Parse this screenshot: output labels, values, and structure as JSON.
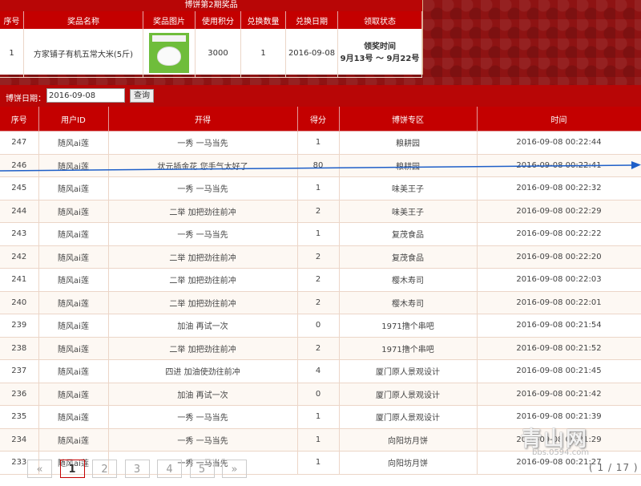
{
  "prize": {
    "title": "博饼第2期奖品",
    "headers": [
      "序号",
      "奖品名称",
      "奖品图片",
      "使用积分",
      "兑换数量",
      "兑换日期",
      "领取状态"
    ],
    "row": {
      "index": "1",
      "name": "方家铺子有机五常大米(5斤)",
      "points": "3000",
      "quantity": "1",
      "date": "2016-09-08",
      "claim_title": "领奖时间",
      "claim_range": "9月13号 ～ 9月22号"
    }
  },
  "filter": {
    "label": "博饼日期：",
    "date_value": "2016-09-08",
    "query_label": "查询"
  },
  "table": {
    "headers": [
      "序号",
      "用户ID",
      "开得",
      "得分",
      "博饼专区",
      "时间"
    ],
    "rows": [
      {
        "no": "247",
        "user": "随风ai莲",
        "result": "一秀 一马当先",
        "score": "1",
        "zone": "粮耕园",
        "time": "2016-09-08 00:22:44"
      },
      {
        "no": "246",
        "user": "随风ai莲",
        "result": "状元插金花 您手气太好了",
        "score": "80",
        "zone": "粮耕园",
        "time": "2016-09-08 00:22:41"
      },
      {
        "no": "245",
        "user": "随风ai莲",
        "result": "一秀 一马当先",
        "score": "1",
        "zone": "味美王子",
        "time": "2016-09-08 00:22:32"
      },
      {
        "no": "244",
        "user": "随风ai莲",
        "result": "二举 加把劲往前冲",
        "score": "2",
        "zone": "味美王子",
        "time": "2016-09-08 00:22:29"
      },
      {
        "no": "243",
        "user": "随风ai莲",
        "result": "一秀 一马当先",
        "score": "1",
        "zone": "复茂食品",
        "time": "2016-09-08 00:22:22"
      },
      {
        "no": "242",
        "user": "随风ai莲",
        "result": "二举 加把劲往前冲",
        "score": "2",
        "zone": "复茂食品",
        "time": "2016-09-08 00:22:20"
      },
      {
        "no": "241",
        "user": "随风ai莲",
        "result": "二举 加把劲往前冲",
        "score": "2",
        "zone": "樱木寿司",
        "time": "2016-09-08 00:22:03"
      },
      {
        "no": "240",
        "user": "随风ai莲",
        "result": "二举 加把劲往前冲",
        "score": "2",
        "zone": "樱木寿司",
        "time": "2016-09-08 00:22:01"
      },
      {
        "no": "239",
        "user": "随风ai莲",
        "result": "加油 再试一次",
        "score": "0",
        "zone": "1971撸个串吧",
        "time": "2016-09-08 00:21:54"
      },
      {
        "no": "238",
        "user": "随风ai莲",
        "result": "二举 加把劲往前冲",
        "score": "2",
        "zone": "1971撸个串吧",
        "time": "2016-09-08 00:21:52"
      },
      {
        "no": "237",
        "user": "随风ai莲",
        "result": "四进 加油使劲往前冲",
        "score": "4",
        "zone": "厦门原人景观设计",
        "time": "2016-09-08 00:21:45"
      },
      {
        "no": "236",
        "user": "随风ai莲",
        "result": "加油 再试一次",
        "score": "0",
        "zone": "厦门原人景观设计",
        "time": "2016-09-08 00:21:42"
      },
      {
        "no": "235",
        "user": "随风ai莲",
        "result": "一秀 一马当先",
        "score": "1",
        "zone": "厦门原人景观设计",
        "time": "2016-09-08 00:21:39"
      },
      {
        "no": "234",
        "user": "随风ai莲",
        "result": "一秀 一马当先",
        "score": "1",
        "zone": "向阳坊月饼",
        "time": "2016-09-08 00:21:29"
      },
      {
        "no": "233",
        "user": "随风ai莲",
        "result": "一秀 一马当先",
        "score": "1",
        "zone": "向阳坊月饼",
        "time": "2016-09-08 00:21:27"
      }
    ]
  },
  "pagination": {
    "prev": "«",
    "pages": [
      "1",
      "2",
      "3",
      "4",
      "5"
    ],
    "next": "»",
    "current": "1",
    "summary": "( 1 / 17 )"
  },
  "watermark": {
    "text": "青山网",
    "url": "bbs.0594.com"
  },
  "colors": {
    "header_red": "#c40000",
    "banner_red": "#8e1313",
    "arrow_blue": "#1e5fc8"
  }
}
